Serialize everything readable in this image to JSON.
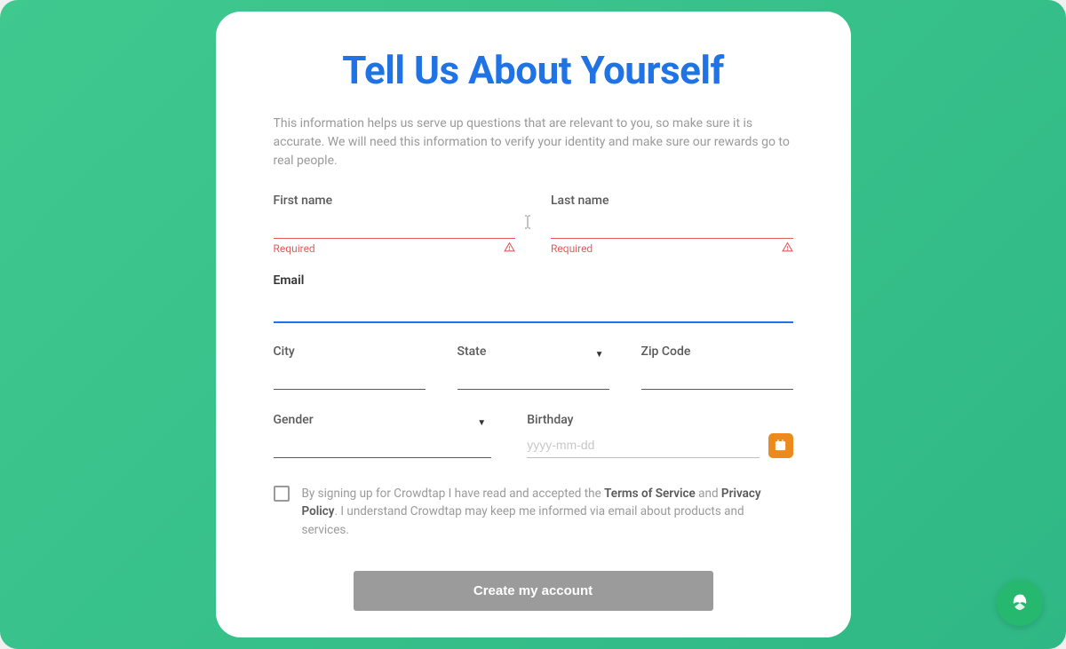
{
  "title": "Tell Us About Yourself",
  "description": "This information helps us serve up questions that are relevant to you, so make sure it is accurate. We will need this information to verify your identity and make sure our rewards go to real people.",
  "fields": {
    "first_name": {
      "label": "First name",
      "value": "",
      "error": "Required"
    },
    "last_name": {
      "label": "Last name",
      "value": "",
      "error": "Required"
    },
    "email": {
      "label": "Email",
      "value": ""
    },
    "city": {
      "label": "City",
      "value": ""
    },
    "state": {
      "label": "State",
      "value": ""
    },
    "zip": {
      "label": "Zip Code",
      "value": ""
    },
    "gender": {
      "label": "Gender",
      "value": ""
    },
    "birthday": {
      "label": "Birthday",
      "placeholder": "yyyy-mm-dd",
      "value": ""
    }
  },
  "consent": {
    "prefix": "By signing up for Crowdtap I have read and accepted the ",
    "tos": "Terms of Service",
    "and": " and ",
    "privacy": "Privacy Policy",
    "suffix": ". I understand Crowdtap may keep me informed via email about products and services."
  },
  "submit_label": "Create my account"
}
